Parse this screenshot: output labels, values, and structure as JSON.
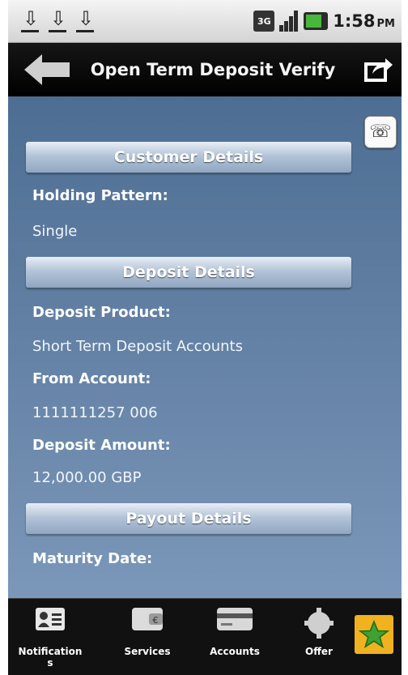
{
  "status_bar": {
    "download_icons": [
      "download-icon",
      "download-icon",
      "download-icon"
    ],
    "network_type": "3G",
    "time": "1:58",
    "ampm": "PM"
  },
  "header": {
    "title": "Open Term Deposit Verify"
  },
  "sections": {
    "customer": {
      "title": "Customer Details",
      "holding_pattern_label": "Holding Pattern:",
      "holding_pattern_value": "Single"
    },
    "deposit": {
      "title": "Deposit Details",
      "product_label": "Deposit Product:",
      "product_value": "Short Term Deposit Accounts",
      "from_account_label": "From Account:",
      "from_account_value": "1111111257 006",
      "amount_label": "Deposit Amount:",
      "amount_value": "12,000.00 GBP"
    },
    "payout": {
      "title": "Payout Details",
      "maturity_date_label": "Maturity Date:"
    }
  },
  "tabs": {
    "notifications": {
      "label_line1": "Notification",
      "label_line2": "s",
      "icon": "contact-card-icon"
    },
    "services": {
      "label": "Services",
      "icon": "wallet-icon"
    },
    "accounts": {
      "label": "Accounts",
      "icon": "credit-card-icon"
    },
    "offers": {
      "label": "Offer",
      "icon": "gear-icon"
    },
    "favorite": {
      "icon": "star-icon",
      "color": "#f1b21f"
    }
  },
  "colors": {
    "content_bg_top": "#4d6d92",
    "content_bg_bottom": "#7b97b9",
    "favorite_star": "#3fa132"
  }
}
